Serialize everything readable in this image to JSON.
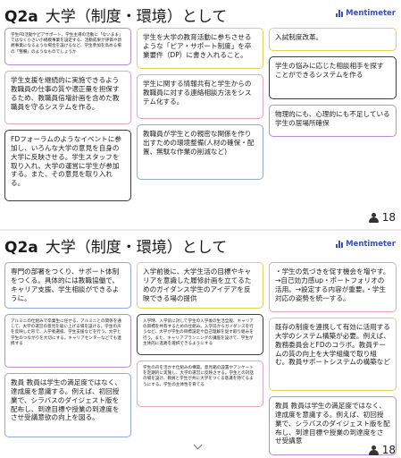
{
  "brand": {
    "name": "Mentimeter",
    "icon": "mentimeter-bars-icon",
    "color": "#3a4fb8"
  },
  "top": {
    "q_label": "Q2a",
    "question": "大学（制度・環境）として",
    "participants": "18",
    "cards": [
      {
        "text": "学生FD活動やピアサポート、学生主導の活動に「ないまま」ではなく小さい小規模事業を設定する、活動成果が評価や新規事業になるような場合を設けるなど、学生参加を高める場の「整備」のようなものでしょうか",
        "color": "purple",
        "size": "tiny"
      },
      {
        "text": "学生を大学の教育活動に参ちさせるような「ピア・サポート制度」を卒業要件（DP）に書き入れること。",
        "color": "yellow",
        "size": "normal"
      },
      {
        "text": "入試制度改革。",
        "color": "yellow",
        "size": "normal"
      },
      {
        "text": "学生支援を継続的に実施できるよう教職員の仕事の質や適正量を担保するため、教職員倍増計画を含めた教職員を守るシステムを作る。",
        "color": "pink",
        "size": "normal"
      },
      {
        "text": "学生に関する情報共有と学生からの教職員に対する連絡相談方法をシステム化する。",
        "color": "pink",
        "size": "normal"
      },
      {
        "text": "学生の悩みに応じた相談相手を探すことができるシステムを作る",
        "color": "dark",
        "size": "normal"
      },
      {
        "text": "物理的にも、心理的にも不足している学生の居場所確保",
        "color": "purple",
        "size": "normal"
      },
      {
        "text": "FDフォーラムのようなイベントに参加し、いろんな大学の意見を自身の大学に反映させる。学生スタッフを取り入れ、大学の運営に学生が参加する。また、その意見を取り入れる。",
        "color": "dark",
        "size": "normal"
      },
      {
        "text": "教職員が学生との親密な関係を作り出すための環境整備(人材の確保・配置、無駄な作業の削減など)",
        "color": "blue",
        "size": "normal"
      }
    ]
  },
  "bottom": {
    "q_label": "Q2a",
    "question": "大学（制度・環境）として",
    "participants": "18",
    "cards": [
      {
        "text": "専門の部署をつくり、サポート体制をつくる。具体的には教職協働で、キャリア支援、学生相談ができるように。",
        "color": "blue",
        "size": "normal"
      },
      {
        "text": "入学前後に、大学生活の目標やキャリアを意識した履修計画を立てるためのガイダンス学生のアイデアを反映できる場の提供",
        "color": "yellow",
        "size": "normal"
      },
      {
        "text": "・学生の気づきを促す機会を増やす。→自己効力感up・ポートフォリオの活用。→設定する内容が重要。・学生対応の姿勢を統一する。",
        "color": "pink",
        "size": "normal"
      },
      {
        "text": "アルミニの仕組みで卒業生に任せる、アルミニとの関係を通して、大学の運営の意見を吸い上げる場を設ける。学生の声を反映した形で、入学者選抜、学生支援などを行う。大学と学生のつながりを大切にする。キャリアセンターなどでも連携する",
        "color": "purple",
        "size": "tiny"
      },
      {
        "text": "入学時、入学前に対して学生の入学後の生活全般、キャリアの目標を共有するための仕組み。入学前からガイダンスを行うなど、大学が学生の目標設定や自己理解を促す取り組みを行う。また、キャリアプランニングの講座を設けて、学生が主体的に進路を選択できるようにする",
        "color": "dark",
        "size": "tiny"
      },
      {
        "text": "既存の制度を連携して有効に活用する大学のシステム構築が必要。例えば、教務委員会とFDのコラボ。教員チームの質の向上を大学組織で取り組む。教員サポートシステムの構築など",
        "color": "yellow",
        "size": "normal"
      },
      {
        "text": "教員 教員は学生の満足度ではなく、達成度を意識する。例えば、初回授業で、シラバスのダイジェスト版を配布し、到達目標や授業の到達度をさせ受講意欲の向上を図る。",
        "color": "blue",
        "size": "normal"
      },
      {
        "text": "学生の声を活かす仕組みの構築。意見箱の設置やアンケートを定期的に実施し、大学の運営に反映させる。学生との対話の場を設け、教員と学生が共に大学をつくる意識を持てるようにする。学生の主体性を育てる",
        "color": "pink",
        "size": "tiny"
      },
      {
        "text": "教員 教員は学生の満足度ではなく、達成度を意識する。例えば、初回授業で、シラバスのダイジェスト版を配布し、到達目標や授業の到達度をさせ受講意",
        "color": "purple",
        "size": "normal"
      }
    ]
  },
  "colors": {
    "purple": "#b98bd8",
    "yellow": "#e8cf5c",
    "pink": "#eba2c0",
    "blue": "#8fa9e0",
    "dark": "#3c3c46"
  },
  "icons": {
    "participants": "person-icon",
    "scroll": "chevron-down-icon"
  }
}
